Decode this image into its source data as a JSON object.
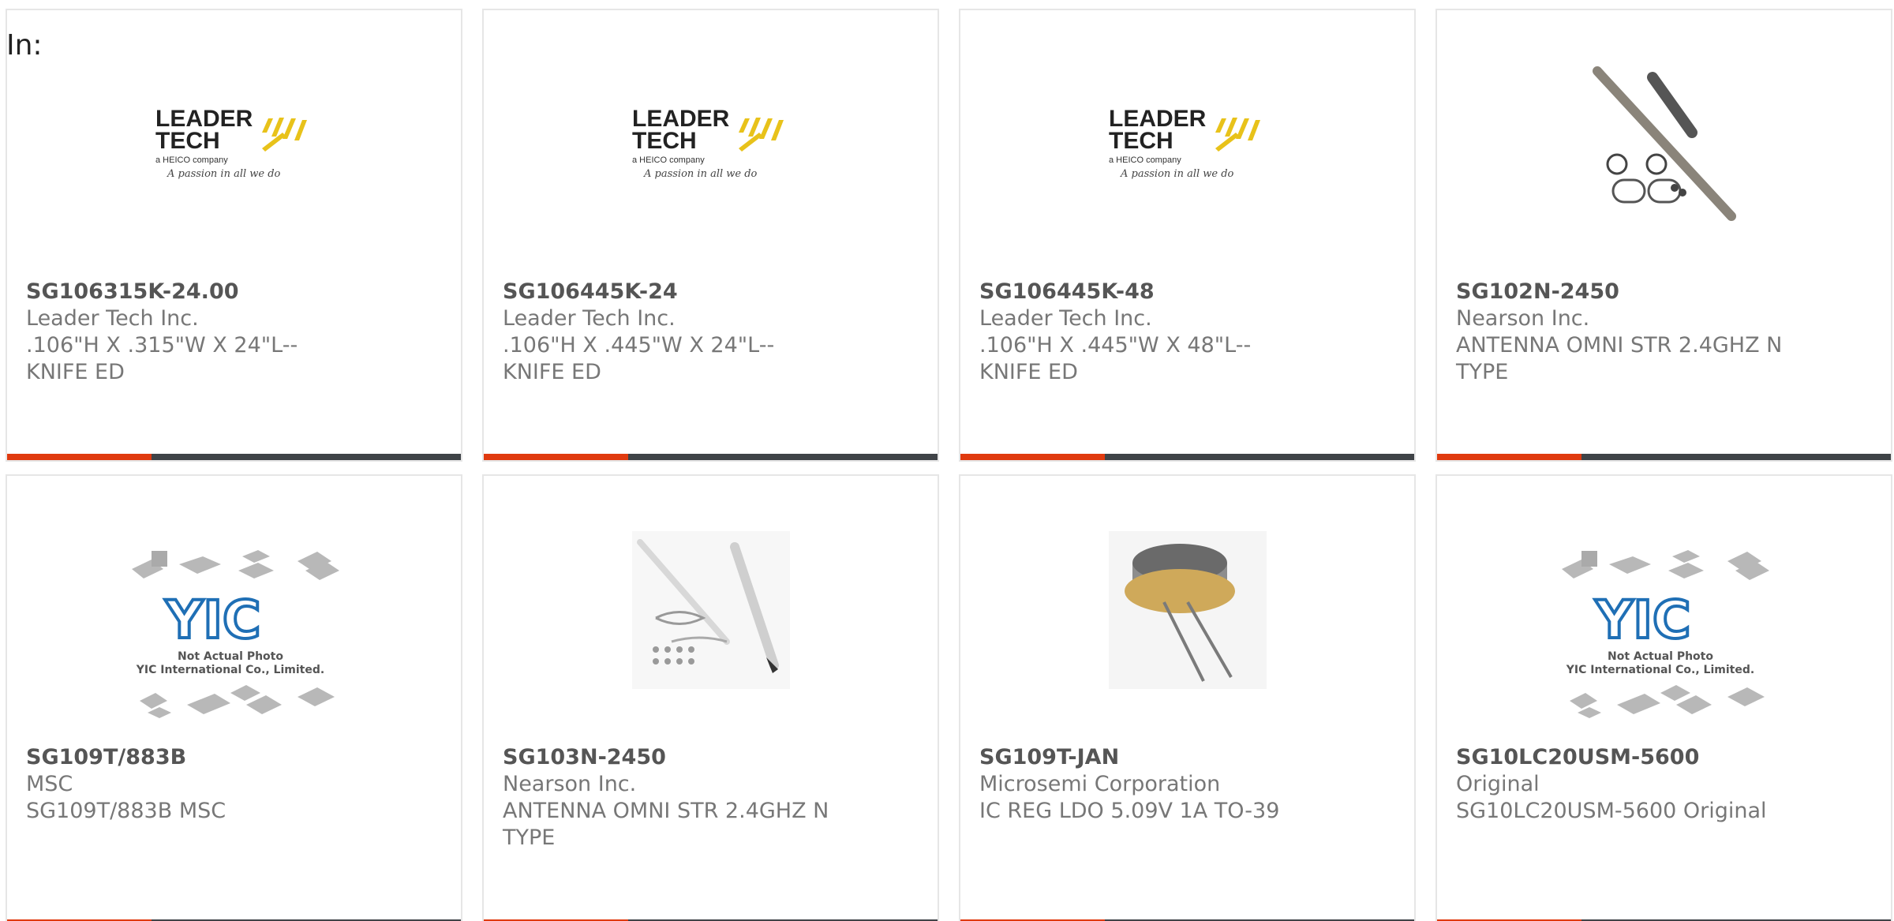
{
  "filter_label": "In:",
  "products": [
    {
      "part_number": "SG106315K-24.00",
      "manufacturer": "Leader Tech Inc.",
      "description": ".106\"H X .315\"W X 24\"L--KNIFE ED",
      "image": "leader-tech-logo"
    },
    {
      "part_number": "SG106445K-24",
      "manufacturer": "Leader Tech Inc.",
      "description": ".106\"H X .445\"W X 24\"L--KNIFE ED",
      "image": "leader-tech-logo"
    },
    {
      "part_number": "SG106445K-48",
      "manufacturer": "Leader Tech Inc.",
      "description": ".106\"H X .445\"W X 48\"L--KNIFE ED",
      "image": "leader-tech-logo"
    },
    {
      "part_number": "SG102N-2450",
      "manufacturer": "Nearson Inc.",
      "description": "ANTENNA OMNI STR 2.4GHZ N TYPE",
      "image": "antenna-photo"
    },
    {
      "part_number": "SG109T/883B",
      "manufacturer": "MSC",
      "description": "SG109T/883B MSC",
      "image": "yic-placeholder"
    },
    {
      "part_number": "SG103N-2450",
      "manufacturer": "Nearson Inc.",
      "description": "ANTENNA OMNI STR 2.4GHZ N TYPE",
      "image": "antenna-white-photo"
    },
    {
      "part_number": "SG109T-JAN",
      "manufacturer": "Microsemi Corporation",
      "description": "IC REG LDO 5.09V 1A TO-39",
      "image": "to39-transistor-photo"
    },
    {
      "part_number": "SG10LC20USM-5600",
      "manufacturer": "Original",
      "description": "SG10LC20USM-5600 Original",
      "image": "yic-placeholder"
    }
  ],
  "logos": {
    "leader_tech": {
      "line1": "LEADER",
      "line2": "TECH",
      "tagline": "a HEICO company",
      "slogan": "A passion in all we do"
    },
    "yic": {
      "mark": "YIC",
      "caption1": "Not Actual Photo",
      "caption2": "YIC International Co., Limited."
    }
  },
  "colors": {
    "accent": "#e03a0f",
    "bar": "#3f4347",
    "logo_yellow": "#e8c21a",
    "yic_blue": "#1f6fb5"
  }
}
